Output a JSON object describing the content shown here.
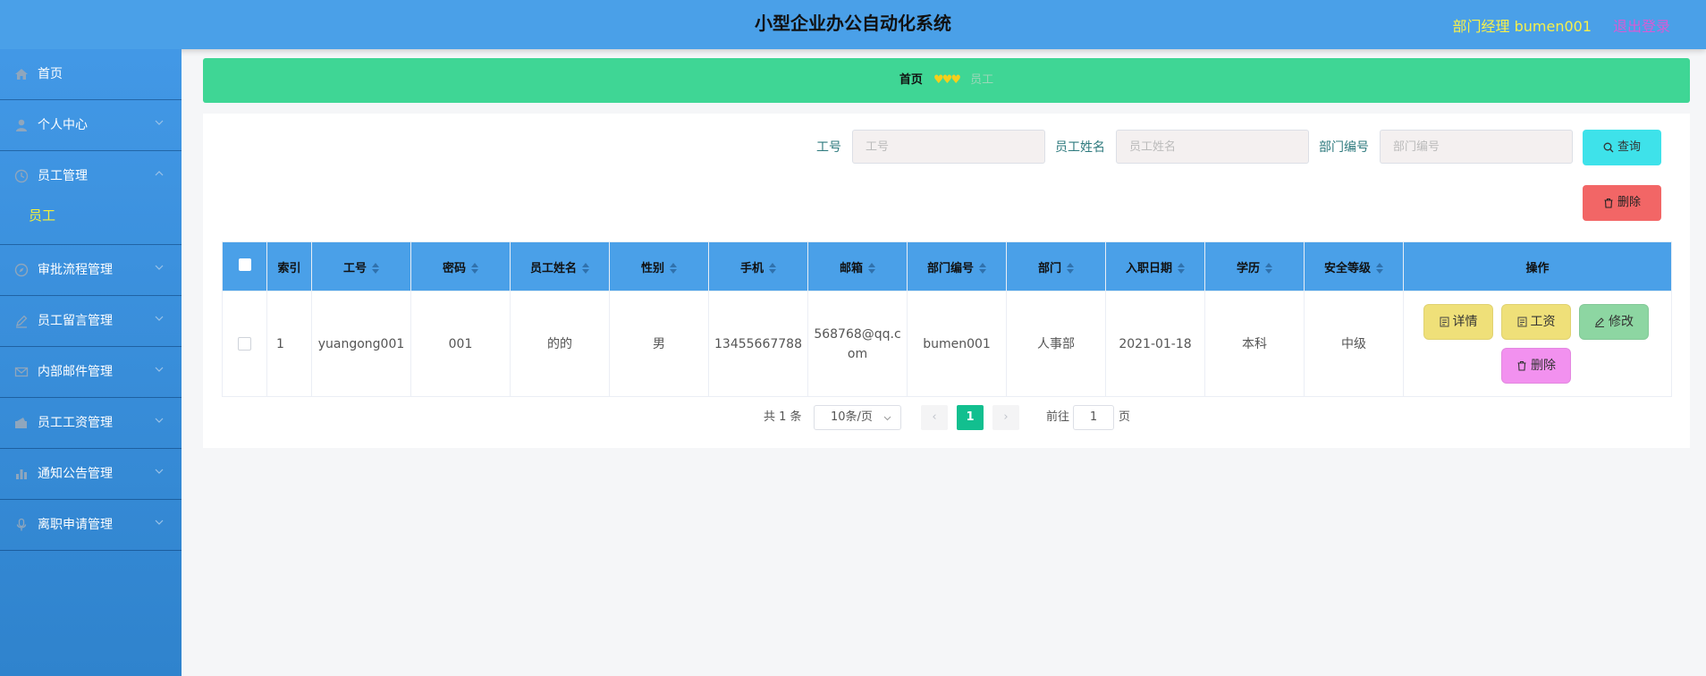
{
  "header": {
    "title": "小型企业办公自动化系统",
    "user": "部门经理 bumen001",
    "logout": "退出登录"
  },
  "sidebar": {
    "items": [
      {
        "label": "首页",
        "icon": "home-icon"
      },
      {
        "label": "个人中心",
        "icon": "user-icon"
      },
      {
        "label": "员工管理",
        "icon": "clock-icon",
        "expanded": true,
        "children": [
          "员工"
        ]
      },
      {
        "label": "审批流程管理",
        "icon": "compass-icon"
      },
      {
        "label": "员工留言管理",
        "icon": "pen-icon"
      },
      {
        "label": "内部邮件管理",
        "icon": "mail-icon"
      },
      {
        "label": "员工工资管理",
        "icon": "wallet-icon"
      },
      {
        "label": "通知公告管理",
        "icon": "chart-icon"
      },
      {
        "label": "离职申请管理",
        "icon": "mic-icon"
      }
    ]
  },
  "breadcrumb": {
    "home": "首页",
    "separator": "♥♥♥",
    "current": "员工"
  },
  "search": {
    "field1": {
      "label": "工号",
      "placeholder": "工号"
    },
    "field2": {
      "label": "员工姓名",
      "placeholder": "员工姓名"
    },
    "field3": {
      "label": "部门编号",
      "placeholder": "部门编号"
    },
    "query_button": "查询",
    "delete_button": "删除"
  },
  "table": {
    "headers": [
      "索引",
      "工号",
      "密码",
      "员工姓名",
      "性别",
      "手机",
      "邮箱",
      "部门编号",
      "部门",
      "入职日期",
      "学历",
      "安全等级",
      "操作"
    ],
    "rows": [
      {
        "index": "1",
        "emp_no": "yuangong001",
        "password": "001",
        "name": "的的",
        "gender": "男",
        "phone": "13455667788",
        "email": "568768@qq.com",
        "dept_no": "bumen001",
        "dept": "人事部",
        "join_date": "2021-01-18",
        "education": "本科",
        "security_level": "中级"
      }
    ],
    "actions": {
      "detail": "详情",
      "salary": "工资",
      "edit": "修改",
      "delete": "删除"
    }
  },
  "pagination": {
    "total": "共 1 条",
    "page_size": "10条/页",
    "current_page": "1",
    "goto_label": "前往",
    "goto_value": "1",
    "goto_suffix": "页"
  },
  "colors": {
    "header_bg": "#4aa0e8",
    "sidebar_bg": "#3a8fdc",
    "breadcrumb_bg": "#3fd695",
    "query_btn": "#3ee2ea",
    "delete_btn": "#f26666",
    "detail_btn": "#efe079",
    "edit_btn": "#8dd6a2",
    "row_delete_btn": "#f291ef",
    "active_page": "#12bf8f"
  }
}
